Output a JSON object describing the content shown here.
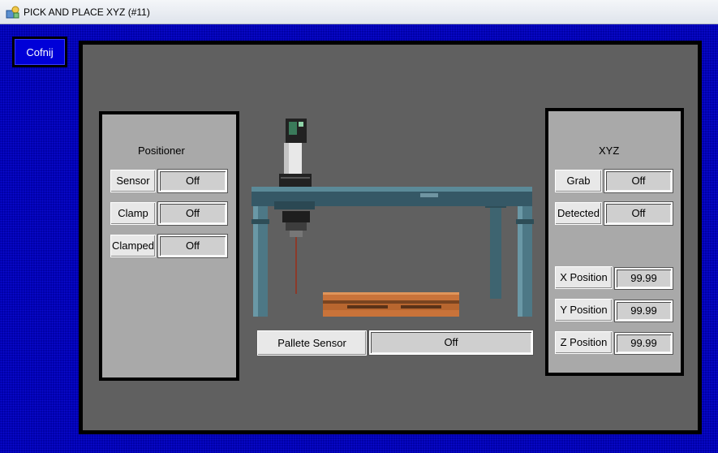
{
  "window": {
    "title": "PICK AND PLACE XYZ (#11)",
    "icon": "app-icon"
  },
  "back_button": {
    "label": "Cofnij"
  },
  "positioner": {
    "title": "Positioner",
    "rows": [
      {
        "label": "Sensor",
        "value": "Off"
      },
      {
        "label": "Clamp",
        "value": "Off"
      },
      {
        "label": "Clamped",
        "value": "Off"
      }
    ]
  },
  "xyz": {
    "title": "XYZ",
    "status_rows": [
      {
        "label": "Grab",
        "value": "Off"
      },
      {
        "label": "Detected",
        "value": "Off"
      }
    ],
    "position_rows": [
      {
        "label": "X Position",
        "value": "99.99"
      },
      {
        "label": "Y Position",
        "value": "99.99"
      },
      {
        "label": "Z Position",
        "value": "99.99"
      }
    ]
  },
  "pallet_sensor": {
    "label": "Pallete Sensor",
    "value": "Off"
  },
  "colors": {
    "frame_blue": "#0000a8",
    "panel_gray": "#606060",
    "side_panel_gray": "#a9a9a9",
    "gantry_teal": "#4d7886",
    "pallet_wood": "#c9733a"
  }
}
